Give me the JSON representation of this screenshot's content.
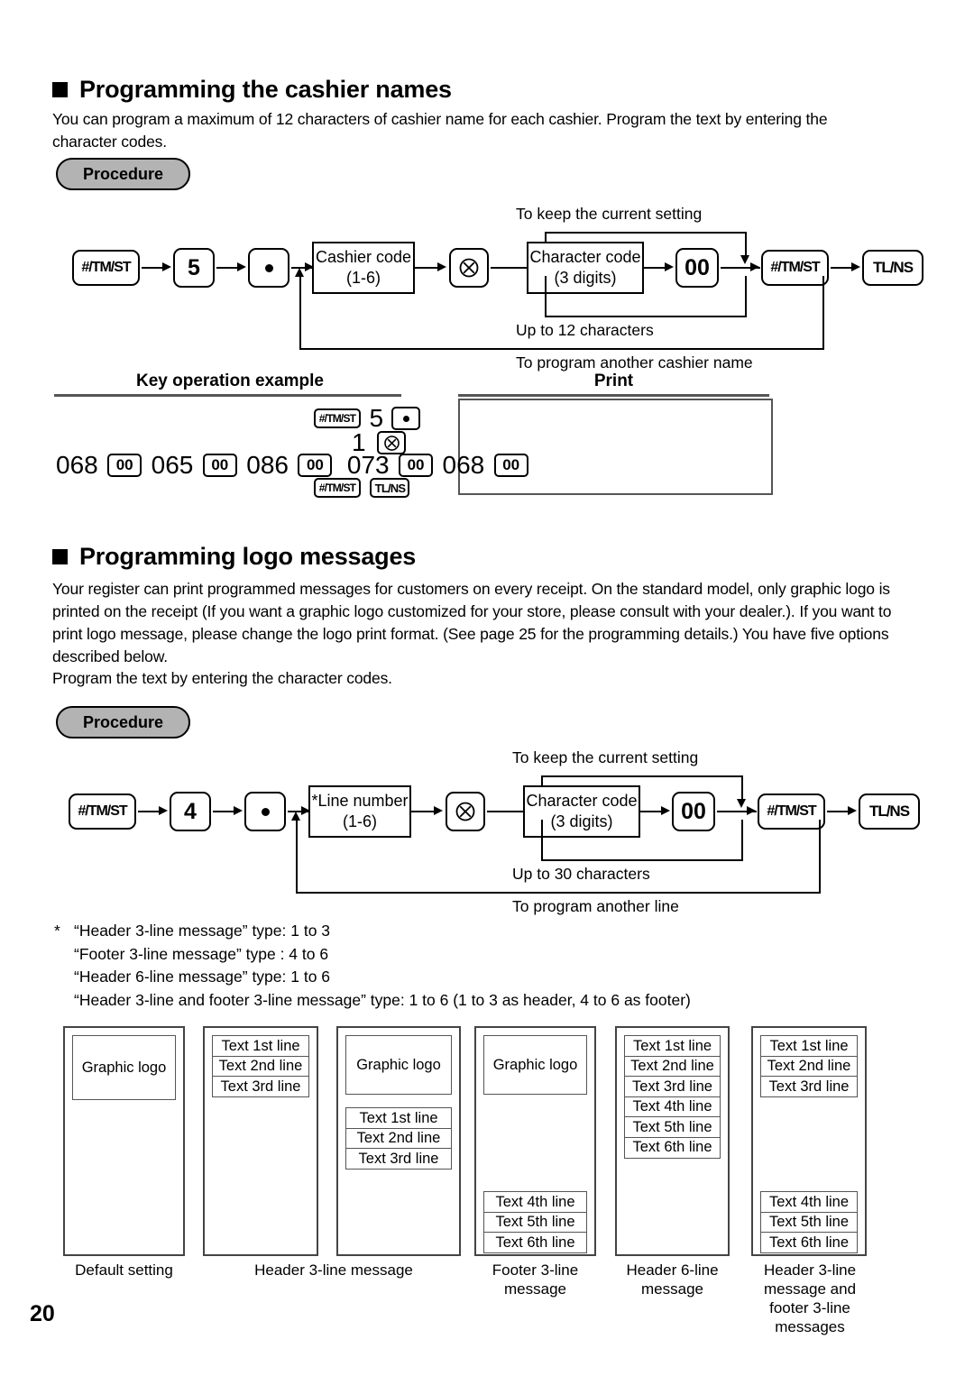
{
  "page_number": "20",
  "section1": {
    "heading": "Programming the cashier names",
    "body": "You can program a maximum of 12 characters of cashier name for each cashier.  Program the text by entering the character codes.",
    "procedure_label": "Procedure",
    "flow": {
      "key1": "#/TM/ST",
      "key2": "5",
      "key3_icon": "dot-key",
      "box1_line1": "Cashier code",
      "box1_line2": "(1-6)",
      "multiply_icon": "multiply-key",
      "box2_line1": "Character code",
      "box2_line2": "(3 digits)",
      "key00": "00",
      "key_tmst": "#/TM/ST",
      "key_tlns": "TL/NS",
      "label_top": "To keep the current setting",
      "label_mid": "Up to 12 characters",
      "label_bottom": "To program another cashier name"
    },
    "example": {
      "col_left_title": "Key operation example",
      "col_right_title": "Print",
      "row1": [
        "#/TM/ST",
        "5",
        "dot-key"
      ],
      "row2": [
        "1",
        "multiply-key"
      ],
      "row3": [
        "068",
        "00",
        "065",
        "00",
        "086",
        "00",
        "073",
        "00",
        "068",
        "00"
      ],
      "row4": [
        "#/TM/ST",
        "TL/NS"
      ],
      "print_content": ""
    }
  },
  "section2": {
    "heading": "Programming logo messages",
    "body": "Your register can print programmed messages for customers on every receipt. On the standard model, only graphic logo is printed on the receipt (If you want a graphic logo customized for your store, please consult with your dealer.).  If you want to print logo message, please change the logo print format. (See page 25 for the programming details.)  You have five options described below.",
    "body2": "Program the text by entering the character codes.",
    "procedure_label": "Procedure",
    "flow": {
      "key1": "#/TM/ST",
      "key2": "4",
      "key3_icon": "dot-key",
      "box1_line1": "*Line number",
      "box1_line2": "(1-6)",
      "multiply_icon": "multiply-key",
      "box2_line1": "Character code",
      "box2_line2": "(3 digits)",
      "key00": "00",
      "key_tmst": "#/TM/ST",
      "key_tlns": "TL/NS",
      "label_top": "To keep the current setting",
      "label_mid": "Up to 30 characters",
      "label_bottom": "To program another line"
    },
    "notes_star": "*",
    "notes": [
      "“Header 3-line message” type: 1 to 3",
      "“Footer 3-line message” type : 4 to 6",
      "“Header 6-line message” type: 1 to 6",
      "“Header 3-line and footer 3-line message” type: 1 to 6 (1 to 3 as header, 4 to 6 as footer)"
    ],
    "receipts": [
      {
        "id": "default-setting",
        "logo": "Graphic logo",
        "top_lines": [],
        "bottom_lines": [],
        "caption": "Default setting"
      },
      {
        "id": "header-3-line-a",
        "logo": "",
        "top_lines": [
          "Text 1st line",
          "Text 2nd line",
          "Text 3rd line"
        ],
        "bottom_lines": [],
        "caption": "Header 3-line message"
      },
      {
        "id": "header-3-line-b",
        "logo": "Graphic logo",
        "top_lines": [
          "Text 1st line",
          "Text 2nd line",
          "Text 3rd line"
        ],
        "bottom_lines": [],
        "caption": ""
      },
      {
        "id": "footer-3-line",
        "logo": "Graphic logo",
        "top_lines": [],
        "bottom_lines": [
          "Text 4th line",
          "Text 5th line",
          "Text 6th line"
        ],
        "caption": "Footer 3-line message"
      },
      {
        "id": "header-6-line",
        "logo": "",
        "top_lines": [
          "Text 1st line",
          "Text 2nd line",
          "Text 3rd line",
          "Text 4th line",
          "Text 5th line",
          "Text 6th line"
        ],
        "bottom_lines": [],
        "caption": "Header 6-line message"
      },
      {
        "id": "header-3-footer-3",
        "logo": "",
        "top_lines": [
          "Text 1st line",
          "Text 2nd line",
          "Text 3rd line"
        ],
        "bottom_lines": [
          "Text 4th line",
          "Text 5th line",
          "Text 6th line"
        ],
        "caption": "Header 3-line message and footer 3-line messages"
      }
    ]
  }
}
